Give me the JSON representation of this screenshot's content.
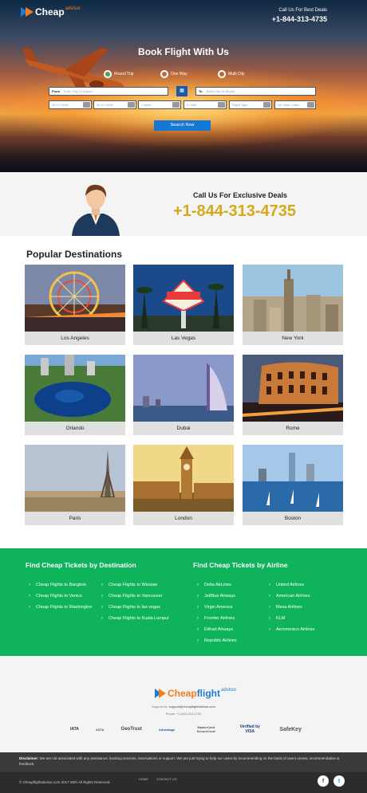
{
  "header": {
    "logo_text": "Cheap",
    "logo_sub": "advisor",
    "call_label": "Call Us For Best Deals",
    "phone": "+1-844-313-4735"
  },
  "search": {
    "title": "Book Flight With Us",
    "trip_types": [
      "Round Trip",
      "One Way",
      "Multi City"
    ],
    "from_label": "From",
    "from_placeholder": "Enter City Or Airport",
    "to_label": "To",
    "to_placeholder": "Enter City Or Airport",
    "depart_date": "26-07-2018",
    "return_date": "30-07-2018",
    "adults": "1 Adult",
    "children": "0 Child",
    "flight_type": "Flight Type",
    "cabin": "All Class-Cabin",
    "button": "Search Now"
  },
  "deals": {
    "label": "Call Us For Exclusive Deals",
    "phone": "+1-844-313-4735"
  },
  "popular": {
    "title": "Popular Destinations",
    "cities": [
      "Los Angeles",
      "Las Vegas",
      "New York",
      "Orlando",
      "Dubai",
      "Rome",
      "Paris",
      "London",
      "Boston"
    ]
  },
  "links": {
    "dest_title": "Find Cheap Tickets by Destination",
    "dest_col1": [
      "Cheap Flights to Bangkok",
      "Cheap Flights to Venice",
      "Cheap Flights to Washington"
    ],
    "dest_col2": [
      "Cheap Flights to Warsaw",
      "Cheap Flights to Vancouver",
      "Cheap Flights to las vegas",
      "Cheap Flights to Kuala Lumpur"
    ],
    "air_title": "Find Cheap Tickets by Airline",
    "air_col1": [
      "Delta AirLines",
      "JetBlue Airways",
      "Virgin America",
      "Frontier Airlines",
      "Etihad Airways",
      "Republic Airlines"
    ],
    "air_col2": [
      "United Airlines",
      "American Airlines",
      "Mesa Airlines",
      "KLM",
      "Aeromexico Airlines"
    ]
  },
  "footer": {
    "logo_text": "Cheap",
    "logo_text2": "flight",
    "logo_sub": "advisor",
    "support_label": "Support by:",
    "support_email": "support@cheapflightadvisor.com",
    "phone_line": "Phone: +1-844-313-4730",
    "badges": [
      "IATA",
      "ASTA",
      "GeoTrust",
      "Advantage",
      "MasterCard SecureCode",
      "Verified by VISA",
      "SafeKey"
    ],
    "disclaimer_label": "Disclaimer:",
    "disclaimer": "We are not associated with any assistance, booking services, reservations or support. We are just trying to help our users by recommending on the basis of users review, recommendation & feedback.",
    "copyright": "© Cheapflightadvisor.com 2017 With All Rights Reserved.",
    "link_home": "HOME",
    "link_contact": "CONTACT US",
    "social": [
      "f",
      "t"
    ]
  },
  "colors": {
    "green": "#0eb35b",
    "gold": "#d6a81c",
    "blue": "#1477d4",
    "orange": "#f27c1f"
  }
}
